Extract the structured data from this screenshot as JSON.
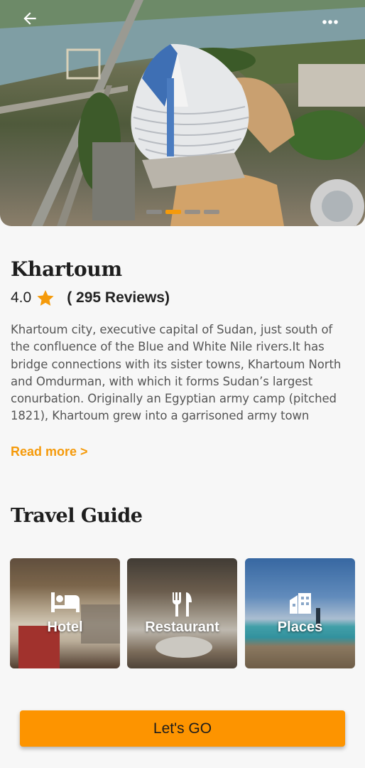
{
  "hero": {
    "back_icon": "arrow-left-icon",
    "more_icon": "more-horizontal-icon",
    "carousel": {
      "count": 4,
      "active_index": 1
    }
  },
  "city": {
    "name": "Khartoum",
    "rating": "4.0",
    "reviews": "( 295 Reviews)",
    "description": "Khartoum city, executive capital of Sudan, just south of the confluence of the Blue and White Nile rivers.It has bridge connections with its sister towns, Khartoum North and Omdurman, with which it forms Sudan’s largest conurbation. Originally an Egyptian army camp (pitched 1821), Khartoum grew into a garrisoned army town",
    "read_more": "Read more >"
  },
  "travel_guide": {
    "title": "Travel Guide",
    "items": [
      {
        "label": "Hotel",
        "icon": "bed-icon"
      },
      {
        "label": "Restaurant",
        "icon": "fork-knife-icon"
      },
      {
        "label": "Places",
        "icon": "building-icon"
      }
    ]
  },
  "cta": {
    "label": "Let's GO"
  },
  "colors": {
    "accent": "#f59a0a",
    "button": "#fd9400",
    "background": "#f7f7f7"
  }
}
